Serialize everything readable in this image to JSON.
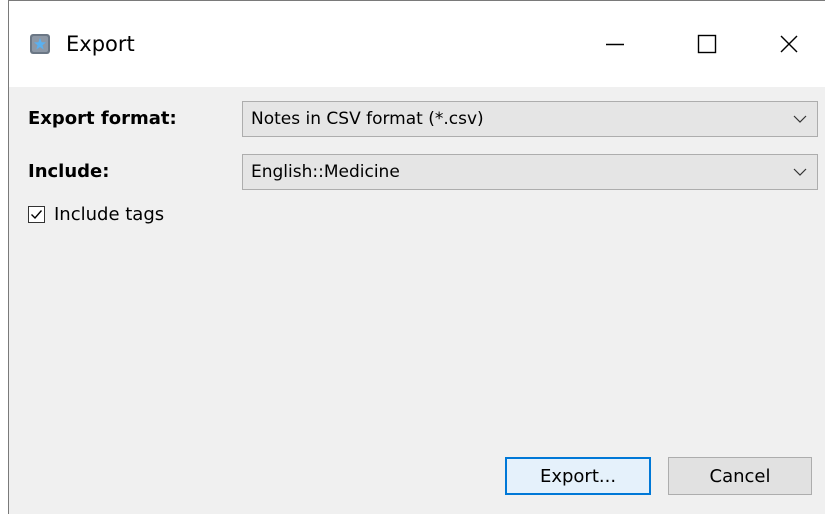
{
  "window": {
    "title": "Export",
    "controls": {
      "minimize": "minimize-icon",
      "maximize": "maximize-icon",
      "close": "close-icon"
    }
  },
  "form": {
    "export_format": {
      "label": "Export format:",
      "value": "Notes in CSV format (*.csv)"
    },
    "include": {
      "label": "Include:",
      "value": "English::Medicine"
    },
    "include_tags": {
      "label": "Include tags",
      "checked": true
    }
  },
  "buttons": {
    "export_label": "Export...",
    "cancel_label": "Cancel"
  },
  "colors": {
    "dialog_bg": "#f0f0f0",
    "titlebar_bg": "#ffffff",
    "default_button_border": "#0078d7",
    "default_button_bg": "#e5f1fb",
    "combo_bg": "#e5e5e5"
  }
}
